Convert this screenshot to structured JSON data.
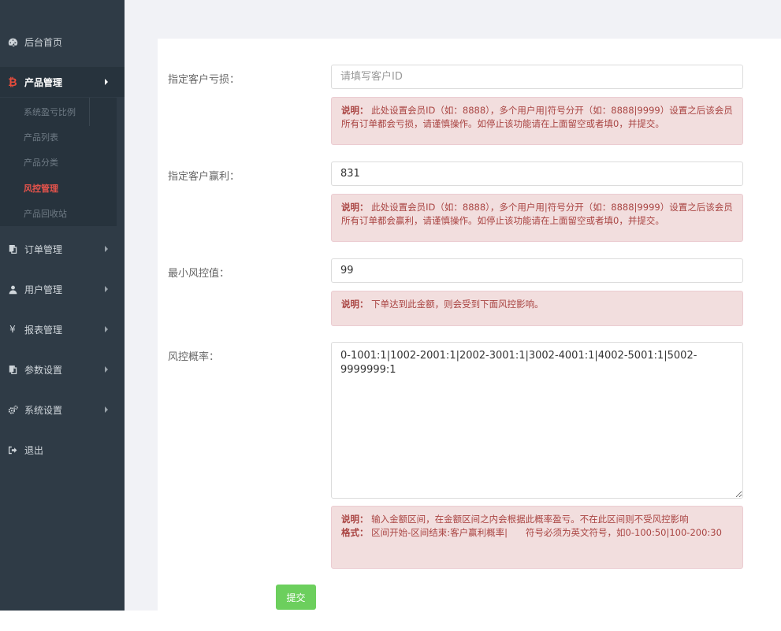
{
  "sidebar": {
    "items": [
      {
        "label": "后台首页",
        "icon": "dashboard-icon"
      },
      {
        "label": "产品管理",
        "icon": "bitcoin-icon"
      },
      {
        "label": "订单管理",
        "icon": "copy-icon"
      },
      {
        "label": "用户管理",
        "icon": "user-icon"
      },
      {
        "label": "报表管理",
        "icon": "yen-icon"
      },
      {
        "label": "参数设置",
        "icon": "copy-icon"
      },
      {
        "label": "系统设置",
        "icon": "gears-icon"
      },
      {
        "label": "退出",
        "icon": "sign-out-icon"
      }
    ],
    "submenu": [
      {
        "label": "系统盈亏比例"
      },
      {
        "label": "产品列表"
      },
      {
        "label": "产品分类"
      },
      {
        "label": "风控管理"
      },
      {
        "label": "产品回收站"
      }
    ]
  },
  "form": {
    "loss": {
      "label": "指定客户亏损：",
      "value": "",
      "placeholder": "请填写客户ID",
      "note_title": "说明：",
      "note_text": "此处设置会员ID（如：8888），多个用户用|符号分开（如：8888|9999）设置之后该会员所有订单都会亏损，请谨慎操作。如停止该功能请在上面留空或者填0，并提交。"
    },
    "win": {
      "label": "指定客户赢利：",
      "value": "831",
      "note_title": "说明：",
      "note_text": "此处设置会员ID（如：8888），多个用户用|符号分开（如：8888|9999）设置之后该会员所有订单都会赢利，请谨慎操作。如停止该功能请在上面留空或者填0，并提交。"
    },
    "min": {
      "label": "最小风控值：",
      "value": "99",
      "note_title": "说明：",
      "note_text": "下单达到此金额，则会受到下面风控影响。"
    },
    "prob": {
      "label": "风控概率：",
      "value": "0-1001:1|1002-2001:1|2002-3001:1|3002-4001:1|4002-5001:1|5002-9999999:1",
      "note_title": "说明：",
      "note_text": "输入金额区间，在金额区间之内会根据此概率盈亏。不在此区间则不受风控影响",
      "format_title": "格式：",
      "format_text": "区间开始-区间结束:客户赢利概率|　　符号必须为英文符号，如0-100:50|100-200:30"
    },
    "submit_label": "提交"
  }
}
